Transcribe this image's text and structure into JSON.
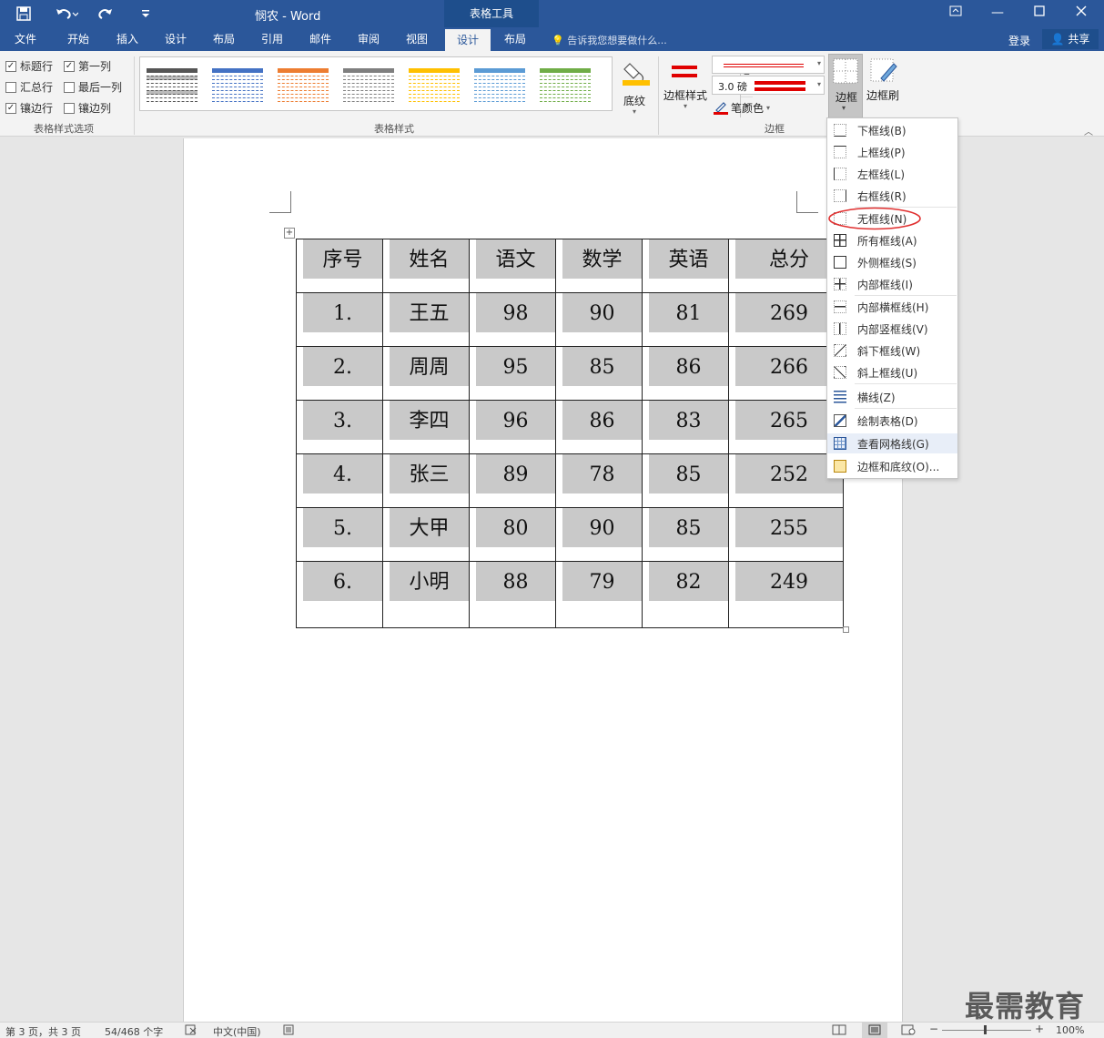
{
  "titlebar": {
    "doc_title": "悯农 - Word",
    "tools_tab": "表格工具",
    "save_icon": "save-icon",
    "undo_icon": "undo-icon",
    "redo_icon": "redo-icon",
    "customize_icon": "customize-qat-icon"
  },
  "menu": {
    "tabs": [
      "文件",
      "开始",
      "插入",
      "设计",
      "布局",
      "引用",
      "邮件",
      "审阅",
      "视图",
      "设计",
      "布局"
    ],
    "active_index": 9,
    "tell_me": "告诉我您想要做什么...",
    "login": "登录",
    "share": "共享"
  },
  "ribbon": {
    "options": {
      "header_row": "标题行",
      "first_column": "第一列",
      "total_row": "汇总行",
      "last_column": "最后一列",
      "banded_rows": "镶边行",
      "banded_columns": "镶边列",
      "checked": {
        "header_row": true,
        "first_column": true,
        "total_row": false,
        "last_column": false,
        "banded_rows": true,
        "banded_columns": false
      },
      "group_label": "表格样式选项"
    },
    "styles": {
      "group_label": "表格样式",
      "colors": [
        "#555555",
        "#4472c4",
        "#ed7d31",
        "#7f7f7f",
        "#ffc000",
        "#5b9bd5",
        "#70ad47"
      ]
    },
    "shading_label": "底纹",
    "border_styles_label": "边框样式",
    "pen_weight": "3.0 磅",
    "pen_color_label": "笔颜色",
    "borders_group_label": "边框",
    "borders_label": "边框",
    "border_painter_label": "边框刷",
    "accent_red": "#e00000",
    "shading_color": "#ffc000"
  },
  "table": {
    "header": [
      "序号",
      "姓名",
      "语文",
      "数学",
      "英语",
      "总分"
    ],
    "rows": [
      [
        "1.",
        "王五",
        "98",
        "90",
        "81",
        "269"
      ],
      [
        "2.",
        "周周",
        "95",
        "85",
        "86",
        "266"
      ],
      [
        "3.",
        "李四",
        "96",
        "86",
        "83",
        "265"
      ],
      [
        "4.",
        "张三",
        "89",
        "78",
        "85",
        "252"
      ],
      [
        "5.",
        "大甲",
        "80",
        "90",
        "85",
        "255"
      ],
      [
        "6.",
        "小明",
        "88",
        "79",
        "82",
        "249"
      ]
    ]
  },
  "border_menu": {
    "items": [
      "下框线(B)",
      "上框线(P)",
      "左框线(L)",
      "右框线(R)",
      "无框线(N)",
      "所有框线(A)",
      "外侧框线(S)",
      "内部框线(I)",
      "内部横框线(H)",
      "内部竖框线(V)",
      "斜下框线(W)",
      "斜上框线(U)",
      "横线(Z)",
      "绘制表格(D)",
      "查看网格线(G)",
      "边框和底纹(O)..."
    ],
    "highlighted_index": 4
  },
  "status": {
    "page": "第 3 页，共 3 页",
    "words": "54/468 个字",
    "language": "中文(中国)",
    "zoom": "100%"
  },
  "watermark": "最需教育"
}
